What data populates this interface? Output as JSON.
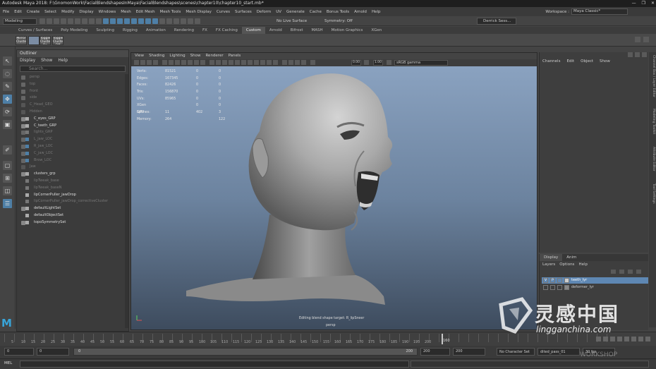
{
  "window": {
    "title": "Autodesk Maya 2018: F:\\GnomonWork\\FacialBlendshapesInMaya\\FacialBlendshapes\\scenes\\chapter10\\chapter10_start.mb*",
    "controls": [
      "—",
      "❐",
      "✕"
    ]
  },
  "menubar": {
    "items": [
      "File",
      "Edit",
      "Create",
      "Select",
      "Modify",
      "Display",
      "Windows",
      "Mesh",
      "Edit Mesh",
      "Mesh Tools",
      "Mesh Display",
      "Curves",
      "Surfaces",
      "Deform",
      "UV",
      "Generate",
      "Cache",
      "Bonus Tools",
      "Arnold",
      "Help"
    ],
    "workspace_label": "Workspace :",
    "workspace_value": "Maya Classic*"
  },
  "statusline": {
    "mode": "Modeling",
    "live_surface": "No Live Surface",
    "symmetry": "Symmetry: Off",
    "user": "Derrick Sess..."
  },
  "shelf": {
    "tabs": [
      "Curves / Surfaces",
      "Poly Modeling",
      "Sculpting",
      "Rigging",
      "Animation",
      "Rendering",
      "FX",
      "FX Caching",
      "Custom",
      "Arnold",
      "Bifrost",
      "MASH",
      "Motion Graphics",
      "XGen"
    ],
    "active_tab": "Custom",
    "buttons": [
      "Mirror Cluster",
      "",
      "Toggle Cluster On",
      "Toggle Cluster Off"
    ]
  },
  "outliner": {
    "title": "Outliner",
    "menu": [
      "Display",
      "Show",
      "Help"
    ],
    "search_placeholder": "Search...",
    "rows": [
      {
        "label": "persp",
        "style": "dim"
      },
      {
        "label": "top",
        "style": "dim"
      },
      {
        "label": "front",
        "style": "dim"
      },
      {
        "label": "side",
        "style": "dim"
      },
      {
        "label": "C_Head_GEO",
        "style": "dim"
      },
      {
        "label": "Hidden",
        "style": "dim"
      },
      {
        "label": "C_eyes_GRP",
        "style": "lt"
      },
      {
        "label": "C_teeth_GRP",
        "style": "lt"
      },
      {
        "label": "lights_GRP",
        "style": "dim"
      },
      {
        "label": "L_jaw_LOC",
        "style": "dim"
      },
      {
        "label": "R_jaw_LOC",
        "style": "dim"
      },
      {
        "label": "C_jaw_LOC",
        "style": "dim"
      },
      {
        "label": "Brow_LOC",
        "style": "dim"
      },
      {
        "label": "Jaw",
        "style": "dim"
      },
      {
        "label": "clusters_grp",
        "style": "lt"
      },
      {
        "label": "lipTweak_base",
        "style": "dim"
      },
      {
        "label": "lipTweak_baseN",
        "style": "dim"
      },
      {
        "label": "lipCornerPuller_jawDrop",
        "style": "lt"
      },
      {
        "label": "lipCornerPuller_jawDrop_correctiveCluster",
        "style": "dim"
      },
      {
        "label": "defaultLightSet",
        "style": "lt"
      },
      {
        "label": "defaultObjectSet",
        "style": "lt"
      },
      {
        "label": "topoSymmetrySet",
        "style": "lt"
      }
    ]
  },
  "viewport": {
    "menu": [
      "View",
      "Shading",
      "Lighting",
      "Show",
      "Renderer",
      "Panels"
    ],
    "exposure": "0.00",
    "gamma": "1.00",
    "color_space": "sRGB gamma",
    "hud": [
      {
        "label": "Verts:",
        "c1": "81521",
        "c2": "0",
        "c3": "0"
      },
      {
        "label": "Edges:",
        "c1": "167345",
        "c2": "0",
        "c3": "0"
      },
      {
        "label": "Faces:",
        "c1": "82426",
        "c2": "0",
        "c3": "0"
      },
      {
        "label": "Tris:",
        "c1": "156870",
        "c2": "0",
        "c3": "0"
      },
      {
        "label": "UVs:",
        "c1": "85965",
        "c2": "0",
        "c3": "0"
      },
      {
        "label": "XGen Splines:",
        "c1": "",
        "c2": "0",
        "c3": "0"
      },
      {
        "label": "GPU Memory:",
        "c1": "11 264",
        "c2": "402",
        "c3": "3 122"
      }
    ],
    "message": "Editing blend shape target: R_lipSneer",
    "camera": "persp"
  },
  "channelbox": {
    "menu": [
      "Channels",
      "Edit",
      "Object",
      "Show"
    ],
    "side_tabs": [
      "Channel Box / Layer Editor",
      "Modeling Toolkit",
      "Attribute Editor",
      "Tool Settings"
    ]
  },
  "layers": {
    "tabs": [
      "Display",
      "Anim"
    ],
    "active_tab": "Display",
    "menu": [
      "Layers",
      "Options",
      "Help"
    ],
    "rows": [
      {
        "v": "V",
        "p": "P",
        "name": "teeth_lyr",
        "selected": true
      },
      {
        "v": "",
        "p": "",
        "name": "deformer_lyr",
        "selected": false
      }
    ]
  },
  "timeslider": {
    "tick_labels": [
      "5",
      "10",
      "15",
      "20",
      "25",
      "30",
      "35",
      "40",
      "45",
      "50",
      "55",
      "60",
      "65",
      "70",
      "75",
      "80",
      "85",
      "90",
      "95",
      "100",
      "105",
      "110",
      "115",
      "120",
      "125",
      "130",
      "135",
      "140",
      "145",
      "150",
      "155",
      "160",
      "165",
      "170",
      "175",
      "180",
      "185",
      "190",
      "195",
      "200"
    ],
    "current_frame": "160"
  },
  "rangeslider": {
    "start": "0",
    "start_inner": "0",
    "range_left": "0",
    "range_right": "200",
    "end_inner": "200",
    "end": "200",
    "character_set": "No Character Set",
    "anim_layer": "dited_pass_01",
    "fps": "30 fps"
  },
  "cmdline": {
    "label": "MEL"
  },
  "watermark": {
    "cn": "灵感中国",
    "url": "lingganchina.com",
    "sub": "WORKSHOP"
  },
  "colors": {
    "accent": "#4e7fa6",
    "selected_layer": "#5e87b3",
    "maya_logo": "#38a4d8"
  }
}
